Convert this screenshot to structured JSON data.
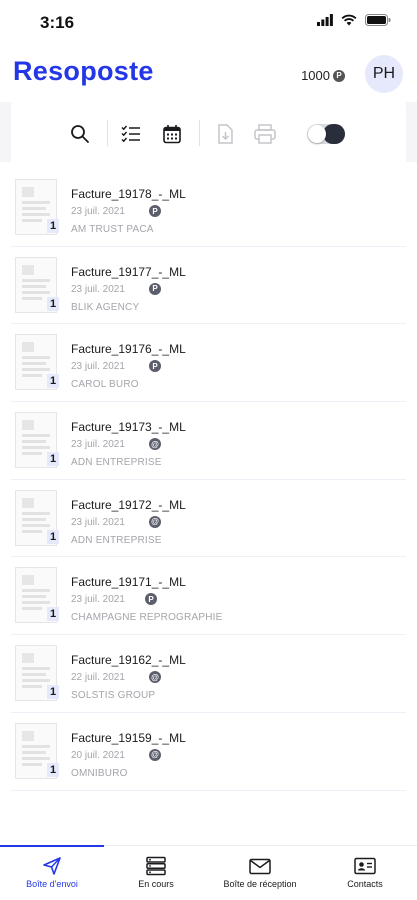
{
  "status_bar": {
    "time": "3:16"
  },
  "header": {
    "brand": "Resoposte",
    "credits": "1000",
    "avatar_initials": "PH"
  },
  "toolbar": {
    "icons": [
      "search-icon",
      "checklist-icon",
      "calendar-icon",
      "download-file-icon",
      "printer-icon",
      "toggle-switch"
    ]
  },
  "documents": [
    {
      "title": "Facture_19178_-_ML",
      "date": "23 juil. 2021",
      "sender": "AM TRUST PACA",
      "pages": "1",
      "status_icon": "P"
    },
    {
      "title": "Facture_19177_-_ML",
      "date": "23 juil. 2021",
      "sender": "BLIK AGENCY",
      "pages": "1",
      "status_icon": "P"
    },
    {
      "title": "Facture_19176_-_ML",
      "date": "23 juil. 2021",
      "sender": "CAROL BURO",
      "pages": "1",
      "status_icon": "P"
    },
    {
      "title": "Facture_19173_-_ML",
      "date": "23 juil. 2021",
      "sender": "ADN ENTREPRISE",
      "pages": "1",
      "status_icon": "@"
    },
    {
      "title": "Facture_19172_-_ML",
      "date": "23 juil. 2021",
      "sender": "ADN ENTREPRISE",
      "pages": "1",
      "status_icon": "@"
    },
    {
      "title": "Facture_19171_-_ML",
      "date": "23 juil. 2021",
      "sender": "CHAMPAGNE REPROGRAPHIE",
      "pages": "1",
      "status_icon": "P"
    },
    {
      "title": "Facture_19162_-_ML",
      "date": "22 juil. 2021",
      "sender": "SOLSTIS GROUP",
      "pages": "1",
      "status_icon": "@"
    },
    {
      "title": "Facture_19159_-_ML",
      "date": "20 juil. 2021",
      "sender": "OMNIBURO",
      "pages": "1",
      "status_icon": "@"
    }
  ],
  "tabs": [
    {
      "label": "Boîte d'envoi",
      "icon": "send-icon",
      "active": true
    },
    {
      "label": "En cours",
      "icon": "server-icon",
      "active": false
    },
    {
      "label": "Boîte de réception",
      "icon": "envelope-icon",
      "active": false
    },
    {
      "label": "Contacts",
      "icon": "contact-card-icon",
      "active": false
    }
  ],
  "colors": {
    "accent": "#2437e6",
    "avatar_bg": "#e6e9fb",
    "muted_text": "#a4a4ab"
  }
}
